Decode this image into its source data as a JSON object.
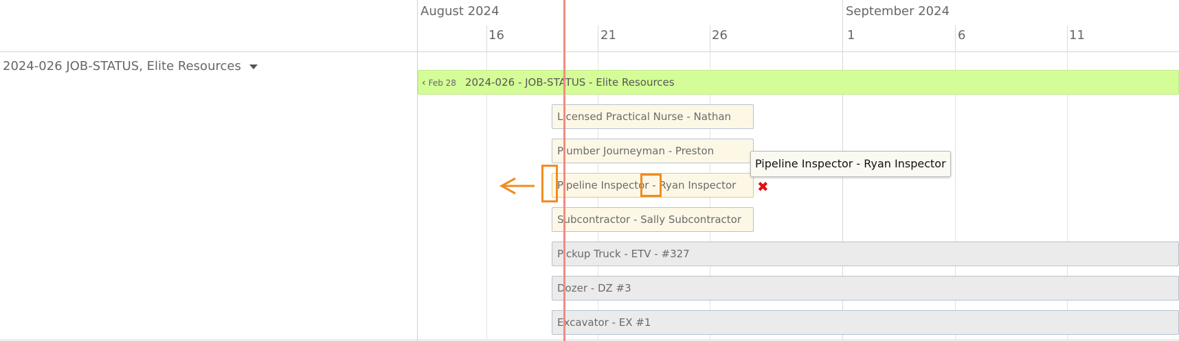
{
  "timeline": {
    "months": [
      "August 2024",
      "September 2024"
    ],
    "days": [
      "16",
      "21",
      "26",
      "1",
      "6",
      "11"
    ]
  },
  "resource_group": {
    "label": "2024-026 JOB-STATUS, Elite Resources"
  },
  "job_bar": {
    "back_date": "Feb 28",
    "label": "2024-026 - JOB-STATUS - Elite Resources"
  },
  "assignments": [
    {
      "label": "Licensed Practical Nurse - Nathan",
      "kind": "person"
    },
    {
      "label": "Plumber Journeyman - Preston",
      "kind": "person"
    },
    {
      "label": "Pipeline Inspector - Ryan Inspector",
      "kind": "person"
    },
    {
      "label": "Subcontractor - Sally Subcontractor",
      "kind": "person"
    },
    {
      "label": "Pickup Truck - ETV - #327",
      "kind": "equipment"
    },
    {
      "label": "Dozer - DZ #3",
      "kind": "equipment"
    },
    {
      "label": "Excavator - EX #1",
      "kind": "equipment"
    }
  ],
  "tooltip": {
    "text": "Pipeline Inspector - Ryan Inspector"
  },
  "delete_symbol": "✖",
  "colors": {
    "job_bar": "#d4fd97",
    "person_bar": "#fdf8e6",
    "equipment_bar": "#ebebeb",
    "today_line": "#f08a82",
    "annotation": "#f08c1e",
    "delete": "#e01010"
  }
}
